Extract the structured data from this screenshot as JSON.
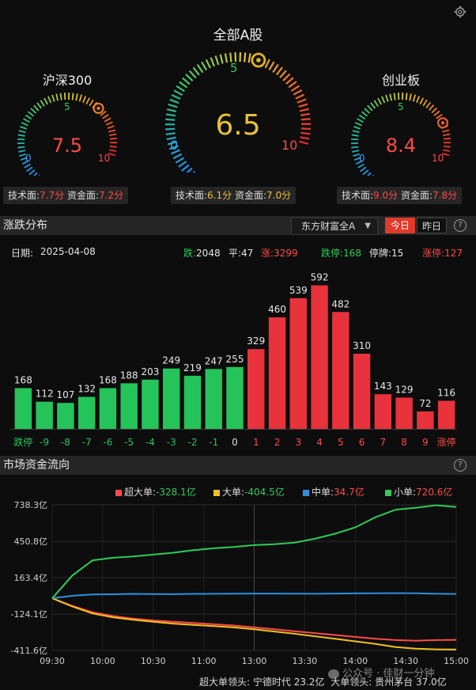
{
  "settings_icon": "gear-icon",
  "gauges": {
    "main": {
      "title": "全部A股",
      "score": "6.5",
      "t0": "0",
      "t5": "5",
      "t10": "10",
      "value": 0.65,
      "score_color": "#e8c13a",
      "tech_label": "技术面:",
      "tech_value": "6.1分",
      "fund_label": "资金面:",
      "fund_value": "7.0分",
      "value_color": "#e8c13a"
    },
    "left": {
      "title": "沪深300",
      "score": "7.5",
      "t0": "0",
      "t5": "5",
      "t10": "10",
      "value": 0.75,
      "score_color": "#ff4a4a",
      "tech_label": "技术面:",
      "tech_value": "7.7分",
      "fund_label": "资金面:",
      "fund_value": "7.2分",
      "value_color": "#ff4a4a"
    },
    "right": {
      "title": "创业板",
      "score": "8.4",
      "t0": "0",
      "t5": "5",
      "t10": "10",
      "value": 0.84,
      "score_color": "#ff4a4a",
      "tech_label": "技术面:",
      "tech_value": "9.0分",
      "fund_label": "资金面:",
      "fund_value": "7.8分",
      "value_color": "#ff4a4a"
    }
  },
  "dist": {
    "title": "涨跌分布",
    "dropdown": "东方财富全A",
    "tab_today": "今日",
    "tab_yesterday": "昨日",
    "help": "?",
    "date_label": "日期:",
    "date": "2025-04-08",
    "down_label": "跌:",
    "down": "2048",
    "flat_label": "平:",
    "flat": "47",
    "up_label": "涨:",
    "up": "3299",
    "limit_down_label": "跌停:",
    "limit_down": "168",
    "halt_label": "停牌:",
    "halt": "15",
    "limit_up_label": "涨停:",
    "limit_up": "127"
  },
  "chart_data": [
    {
      "type": "bar",
      "title": "涨跌分布",
      "categories": [
        "跌停",
        "-9",
        "-8",
        "-7",
        "-6",
        "-5",
        "-4",
        "-3",
        "-2",
        "-1",
        "0",
        "1",
        "2",
        "3",
        "4",
        "5",
        "6",
        "7",
        "8",
        "9",
        "涨停"
      ],
      "values": [
        168,
        112,
        107,
        132,
        168,
        188,
        203,
        249,
        219,
        247,
        255,
        329,
        460,
        539,
        592,
        482,
        310,
        143,
        129,
        72,
        116,
        127
      ],
      "note_categories_count": "21"
    },
    {
      "type": "line",
      "title": "市场资金流向",
      "x_ticks": [
        "09:30",
        "10:00",
        "10:30",
        "11:00",
        "13:00",
        "13:30",
        "14:00",
        "14:30",
        "15:00"
      ],
      "y_ticks": [
        "738.3亿",
        "450.8亿",
        "163.4亿",
        "-124.1亿",
        "-411.6亿"
      ],
      "ylim": [
        -411.6,
        738.3
      ],
      "series": [
        {
          "name": "超大单",
          "value": "-328.1亿",
          "color": "#ff4a4a",
          "values": [
            0,
            -60,
            -110,
            -140,
            -160,
            -175,
            -185,
            -195,
            -205,
            -215,
            -230,
            -245,
            -260,
            -275,
            -290,
            -305,
            -320,
            -330,
            -335,
            -330,
            -328.1
          ]
        },
        {
          "name": "大单",
          "value": "-404.5亿",
          "color": "#f0c020",
          "values": [
            0,
            -65,
            -120,
            -150,
            -170,
            -185,
            -200,
            -210,
            -220,
            -230,
            -245,
            -262,
            -280,
            -300,
            -320,
            -340,
            -360,
            -385,
            -398,
            -403,
            -404.5
          ]
        },
        {
          "name": "中单",
          "value": "34.7亿",
          "color": "#2e8fe0",
          "values": [
            0,
            20,
            30,
            32,
            35,
            34,
            33,
            35,
            36,
            37,
            38,
            38,
            37,
            36,
            38,
            39,
            40,
            41,
            40,
            36,
            34.7
          ]
        },
        {
          "name": "小单",
          "value": "720.6亿",
          "color": "#2ecc5a",
          "values": [
            0,
            180,
            300,
            320,
            330,
            345,
            360,
            380,
            395,
            405,
            420,
            428,
            440,
            470,
            510,
            560,
            640,
            700,
            715,
            735,
            720.6
          ]
        }
      ]
    }
  ],
  "flow": {
    "title": "市场资金流向",
    "help": "?",
    "lead_super_label": "超大单领头:",
    "lead_super": "宁德时代 23.2亿",
    "lead_big_label": "大单领头:",
    "lead_big": "贵州茅台 37.0亿",
    "watermark": "公众号 · 佳财一分钟"
  }
}
